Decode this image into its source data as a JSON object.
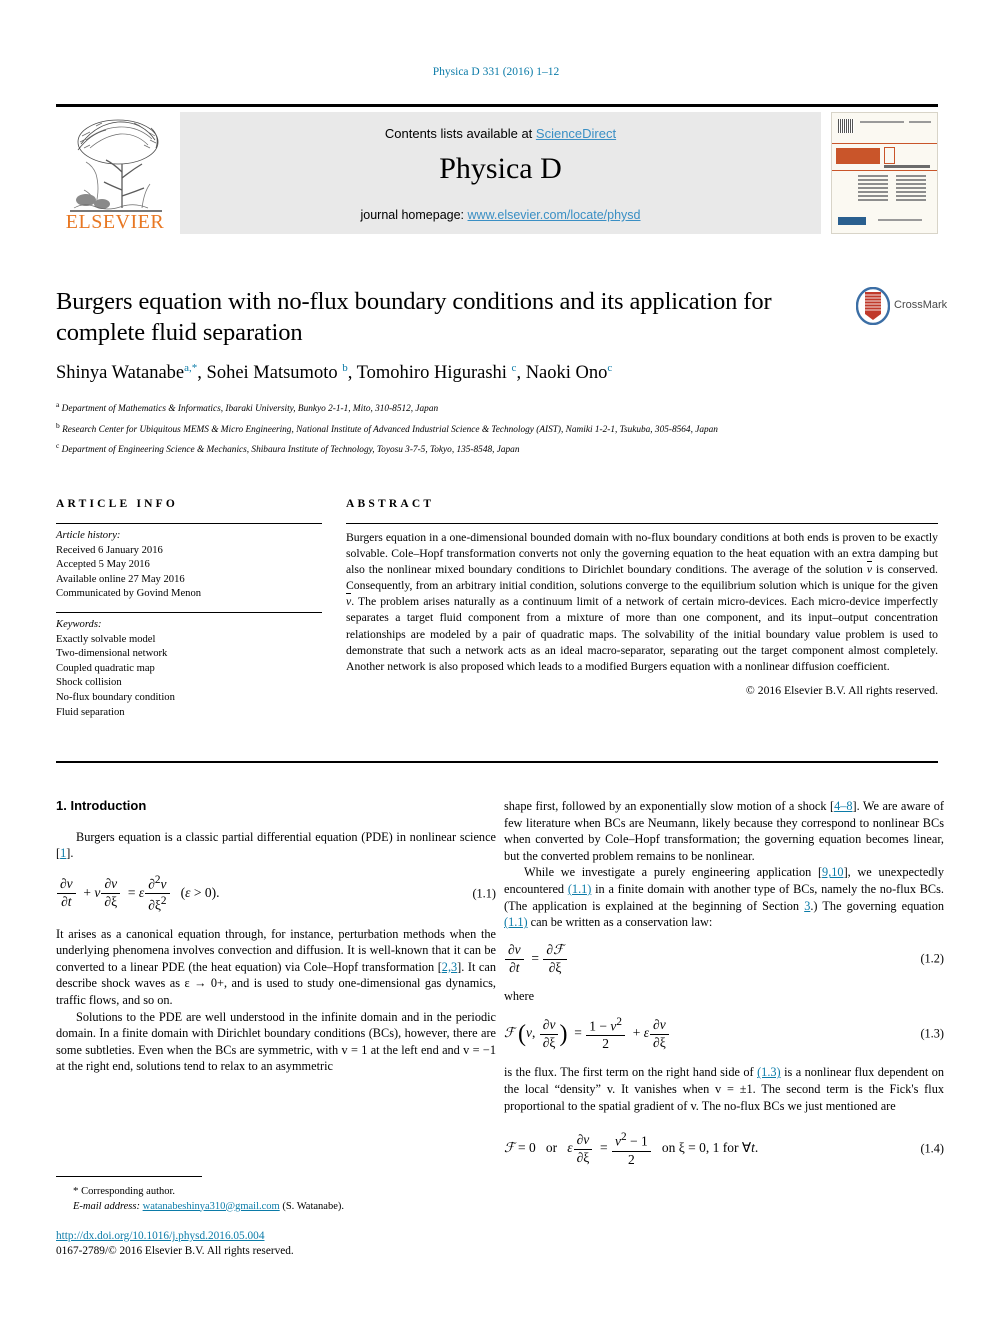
{
  "running_head": "Physica D 331 (2016) 1–12",
  "masthead": {
    "publisher_name": "ELSEVIER",
    "contents_prefix": "Contents lists available at ",
    "contents_link": "ScienceDirect",
    "journal_title": "Physica D",
    "homepage_prefix": "journal homepage: ",
    "homepage_link": "www.elsevier.com/locate/physd",
    "cover_journal_name": "PHYSICA",
    "cover_journal_letter": "D"
  },
  "article": {
    "title": "Burgers equation with no-flux boundary conditions and its application for complete fluid separation",
    "crossmark_label": "CrossMark",
    "authors_html": "Shinya Watanabe<sup>a,*</sup>, Sohei Matsumoto <sup>b</sup>, Tomohiro Higurashi <sup>c</sup>, Naoki Ono<sup>c</sup>",
    "affiliations": [
      {
        "marker": "a",
        "text": "Department of Mathematics & Informatics, Ibaraki University, Bunkyo 2-1-1, Mito, 310-8512, Japan"
      },
      {
        "marker": "b",
        "text": "Research Center for Ubiquitous MEMS & Micro Engineering, National Institute of Advanced Industrial Science & Technology (AIST), Namiki 1-2-1, Tsukuba, 305-8564, Japan"
      },
      {
        "marker": "c",
        "text": "Department of Engineering Science & Mechanics, Shibaura Institute of Technology, Toyosu 3-7-5, Tokyo, 135-8548, Japan"
      }
    ]
  },
  "article_info": {
    "heading": "ARTICLE INFO",
    "history_label": "Article history:",
    "history": [
      "Received 6 January 2016",
      "Accepted 5 May 2016",
      "Available online 27 May 2016",
      "Communicated by Govind Menon"
    ],
    "keywords_label": "Keywords:",
    "keywords": [
      "Exactly solvable model",
      "Two-dimensional network",
      "Coupled quadratic map",
      "Shock collision",
      "No-flux boundary condition",
      "Fluid separation"
    ]
  },
  "abstract": {
    "heading": "ABSTRACT",
    "part1": "Burgers equation in a one-dimensional bounded domain with no-flux boundary conditions at both ends is proven to be exactly solvable. Cole–Hopf transformation converts not only the governing equation to the heat equation with an extra damping but also the nonlinear mixed boundary conditions to Dirichlet boundary conditions. The average of the solution ",
    "vbar1": "v",
    "part2": " is conserved. Consequently, from an arbitrary initial condition, solutions converge to the equilibrium solution which is unique for the given ",
    "vbar2": "v",
    "part3": ". The problem arises naturally as a continuum limit of a network of certain micro-devices. Each micro-device imperfectly separates a target fluid component from a mixture of more than one component, and its input–output concentration relationships are modeled by a pair of quadratic maps. The solvability of the initial boundary value problem is used to demonstrate that such a network acts as an ideal macro-separator, separating out the target component almost completely. Another network is also proposed which leads to a modified Burgers equation with a nonlinear diffusion coefficient.",
    "copyright": "© 2016 Elsevier B.V. All rights reserved."
  },
  "introduction": {
    "section_number": "1.",
    "section_title": "1.  Introduction",
    "p1_a": "Burgers equation is a classic partial differential equation (PDE) in nonlinear science [",
    "p1_ref": "1",
    "p1_b": "].",
    "eq11_number": "(1.1)",
    "p2_a": "It arises as a canonical equation through, for instance, perturbation methods when the underlying phenomena involves convection and diffusion. It is well-known that it can be converted to a linear PDE (the heat equation) via Cole–Hopf transformation [",
    "p2_ref": "2,3",
    "p2_b": "]. It can describe shock waves as ε → 0+, and is used to study one-dimensional gas dynamics, traffic flows, and so on.",
    "p3": "Solutions to the PDE are well understood in the infinite domain and in the periodic domain. In a finite domain with Dirichlet boundary conditions (BCs), however, there are some subtleties. Even when the BCs are symmetric, with v = 1 at the left end and v = −1 at the right end, solutions tend to relax to an asymmetric",
    "p4_a": "shape first, followed by an exponentially slow motion of a shock [",
    "p4_ref": "4–8",
    "p4_b": "]. We are aware of few literature when BCs are Neumann, likely because they correspond to nonlinear BCs when converted by Cole–Hopf transformation; the governing equation becomes linear, but the converted problem remains to be nonlinear.",
    "p5_a": "While we investigate a purely engineering application [",
    "p5_ref1": "9,10",
    "p5_b": "], we unexpectedly encountered ",
    "p5_ref2": "(1.1)",
    "p5_c": " in a finite domain with another type of BCs, namely the no-flux BCs. (The application is explained at the beginning of Section ",
    "p5_ref3": "3",
    "p5_d": ".) The governing equation ",
    "p5_ref4": "(1.1)",
    "p5_e": " can be written as a conservation law:",
    "eq12_number": "(1.2)",
    "where_label": "where",
    "eq13_number": "(1.3)",
    "p6_a": "is the flux. The first term on the right hand side of ",
    "p6_ref": "(1.3)",
    "p6_b": " is a nonlinear flux dependent on the local “density” v. It vanishes when v = ±1. The second term is the Fick's flux proportional to the spatial gradient of v. The no-flux BCs we just mentioned are",
    "eq14_number": "(1.4)"
  },
  "footer": {
    "corresponding_star": "*",
    "corresponding_label": "Corresponding author.",
    "email_label": "E-mail address:",
    "email": "watanabeshinya310@gmail.com",
    "email_suffix": "(S. Watanabe).",
    "doi": "http://dx.doi.org/10.1016/j.physd.2016.05.004",
    "issn_line": "0167-2789/© 2016 Elsevier B.V. All rights reserved."
  },
  "colors": {
    "link_blue": "#0b7ba8",
    "sciencedirect_blue": "#3a8fc4",
    "elsevier_orange": "#E87722",
    "band_gray": "#e9e9e9"
  }
}
